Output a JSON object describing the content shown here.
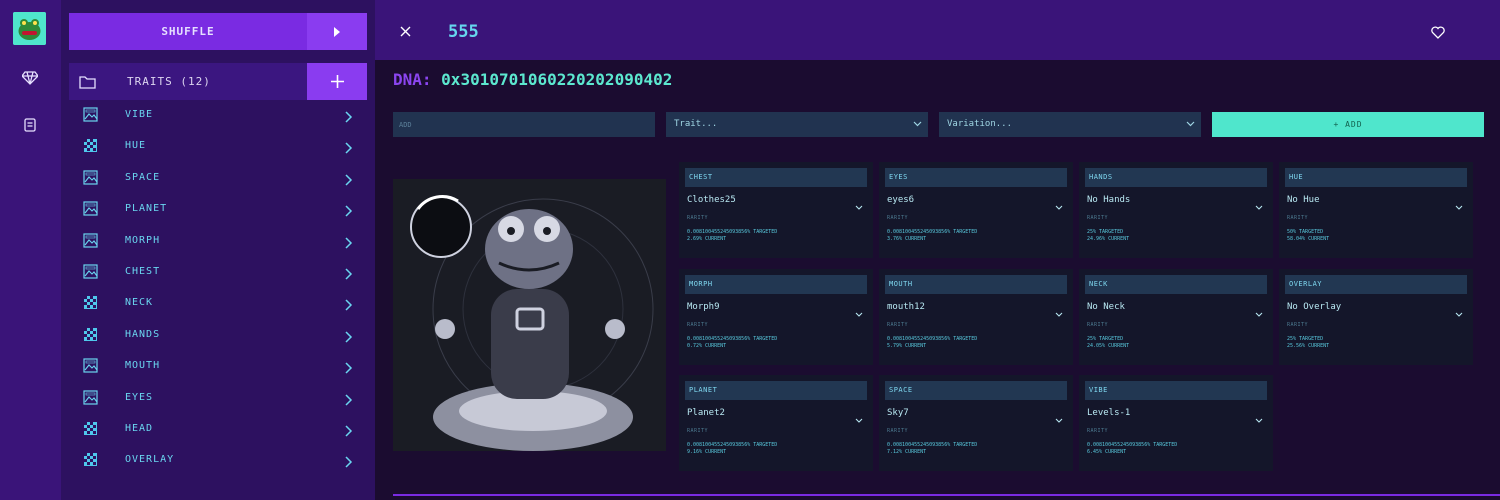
{
  "rail": {
    "items": [
      "frog-logo",
      "gem-icon",
      "scroll-icon"
    ]
  },
  "panel": {
    "shuffle_label": "SHUFFLE",
    "traits_title": "TRAITS (12)",
    "traits": [
      {
        "label": "VIBE",
        "icon": "image-icon"
      },
      {
        "label": "HUE",
        "icon": "checker-icon"
      },
      {
        "label": "SPACE",
        "icon": "image-icon"
      },
      {
        "label": "PLANET",
        "icon": "image-icon"
      },
      {
        "label": "MORPH",
        "icon": "image-icon"
      },
      {
        "label": "CHEST",
        "icon": "image-icon"
      },
      {
        "label": "NECK",
        "icon": "checker-icon"
      },
      {
        "label": "HANDS",
        "icon": "checker-icon"
      },
      {
        "label": "MOUTH",
        "icon": "image-icon"
      },
      {
        "label": "EYES",
        "icon": "image-icon"
      },
      {
        "label": "HEAD",
        "icon": "checker-icon"
      },
      {
        "label": "OVERLAY",
        "icon": "checker-icon"
      }
    ]
  },
  "header": {
    "token": "555"
  },
  "dna": {
    "label": "DNA:",
    "value": "0x3010701060220202090402"
  },
  "add_bar": {
    "input_placeholder": "ADD",
    "trait_select": "Trait...",
    "variation_select": "Variation...",
    "add_label": "+ ADD"
  },
  "cards": [
    {
      "trait": "CHEST",
      "value": "Clothes25",
      "rarity": "RARITY",
      "targeted": "0.008100455245093856% TARGETED",
      "current": "2.69% CURRENT"
    },
    {
      "trait": "EYES",
      "value": "eyes6",
      "rarity": "RARITY",
      "targeted": "0.008100455245093856% TARGETED",
      "current": "3.76% CURRENT"
    },
    {
      "trait": "HANDS",
      "value": "No Hands",
      "rarity": "RARITY",
      "targeted": "25% TARGETED",
      "current": "24.96% CURRENT"
    },
    {
      "trait": "HUE",
      "value": "No Hue",
      "rarity": "RARITY",
      "targeted": "50% TARGETED",
      "current": "58.04% CURRENT"
    },
    {
      "trait": "MORPH",
      "value": "Morph9",
      "rarity": "RARITY",
      "targeted": "0.008100455245093856% TARGETED",
      "current": "0.72% CURRENT"
    },
    {
      "trait": "MOUTH",
      "value": "mouth12",
      "rarity": "RARITY",
      "targeted": "0.008100455245093856% TARGETED",
      "current": "5.79% CURRENT"
    },
    {
      "trait": "NECK",
      "value": "No Neck",
      "rarity": "RARITY",
      "targeted": "25% TARGETED",
      "current": "24.05% CURRENT"
    },
    {
      "trait": "OVERLAY",
      "value": "No Overlay",
      "rarity": "RARITY",
      "targeted": "25% TARGETED",
      "current": "25.56% CURRENT"
    },
    {
      "trait": "PLANET",
      "value": "Planet2",
      "rarity": "RARITY",
      "targeted": "0.008100455245093856% TARGETED",
      "current": "9.16% CURRENT"
    },
    {
      "trait": "SPACE",
      "value": "Sky7",
      "rarity": "RARITY",
      "targeted": "0.008100455245093856% TARGETED",
      "current": "7.12% CURRENT"
    },
    {
      "trait": "VIBE",
      "value": "Levels-1",
      "rarity": "RARITY",
      "targeted": "0.008100455245093856% TARGETED",
      "current": "6.45% CURRENT"
    }
  ],
  "colors": {
    "accent": "#7a2be2",
    "teal": "#4fe6cc",
    "panel": "#2d1160",
    "bg": "#1b0c30"
  }
}
